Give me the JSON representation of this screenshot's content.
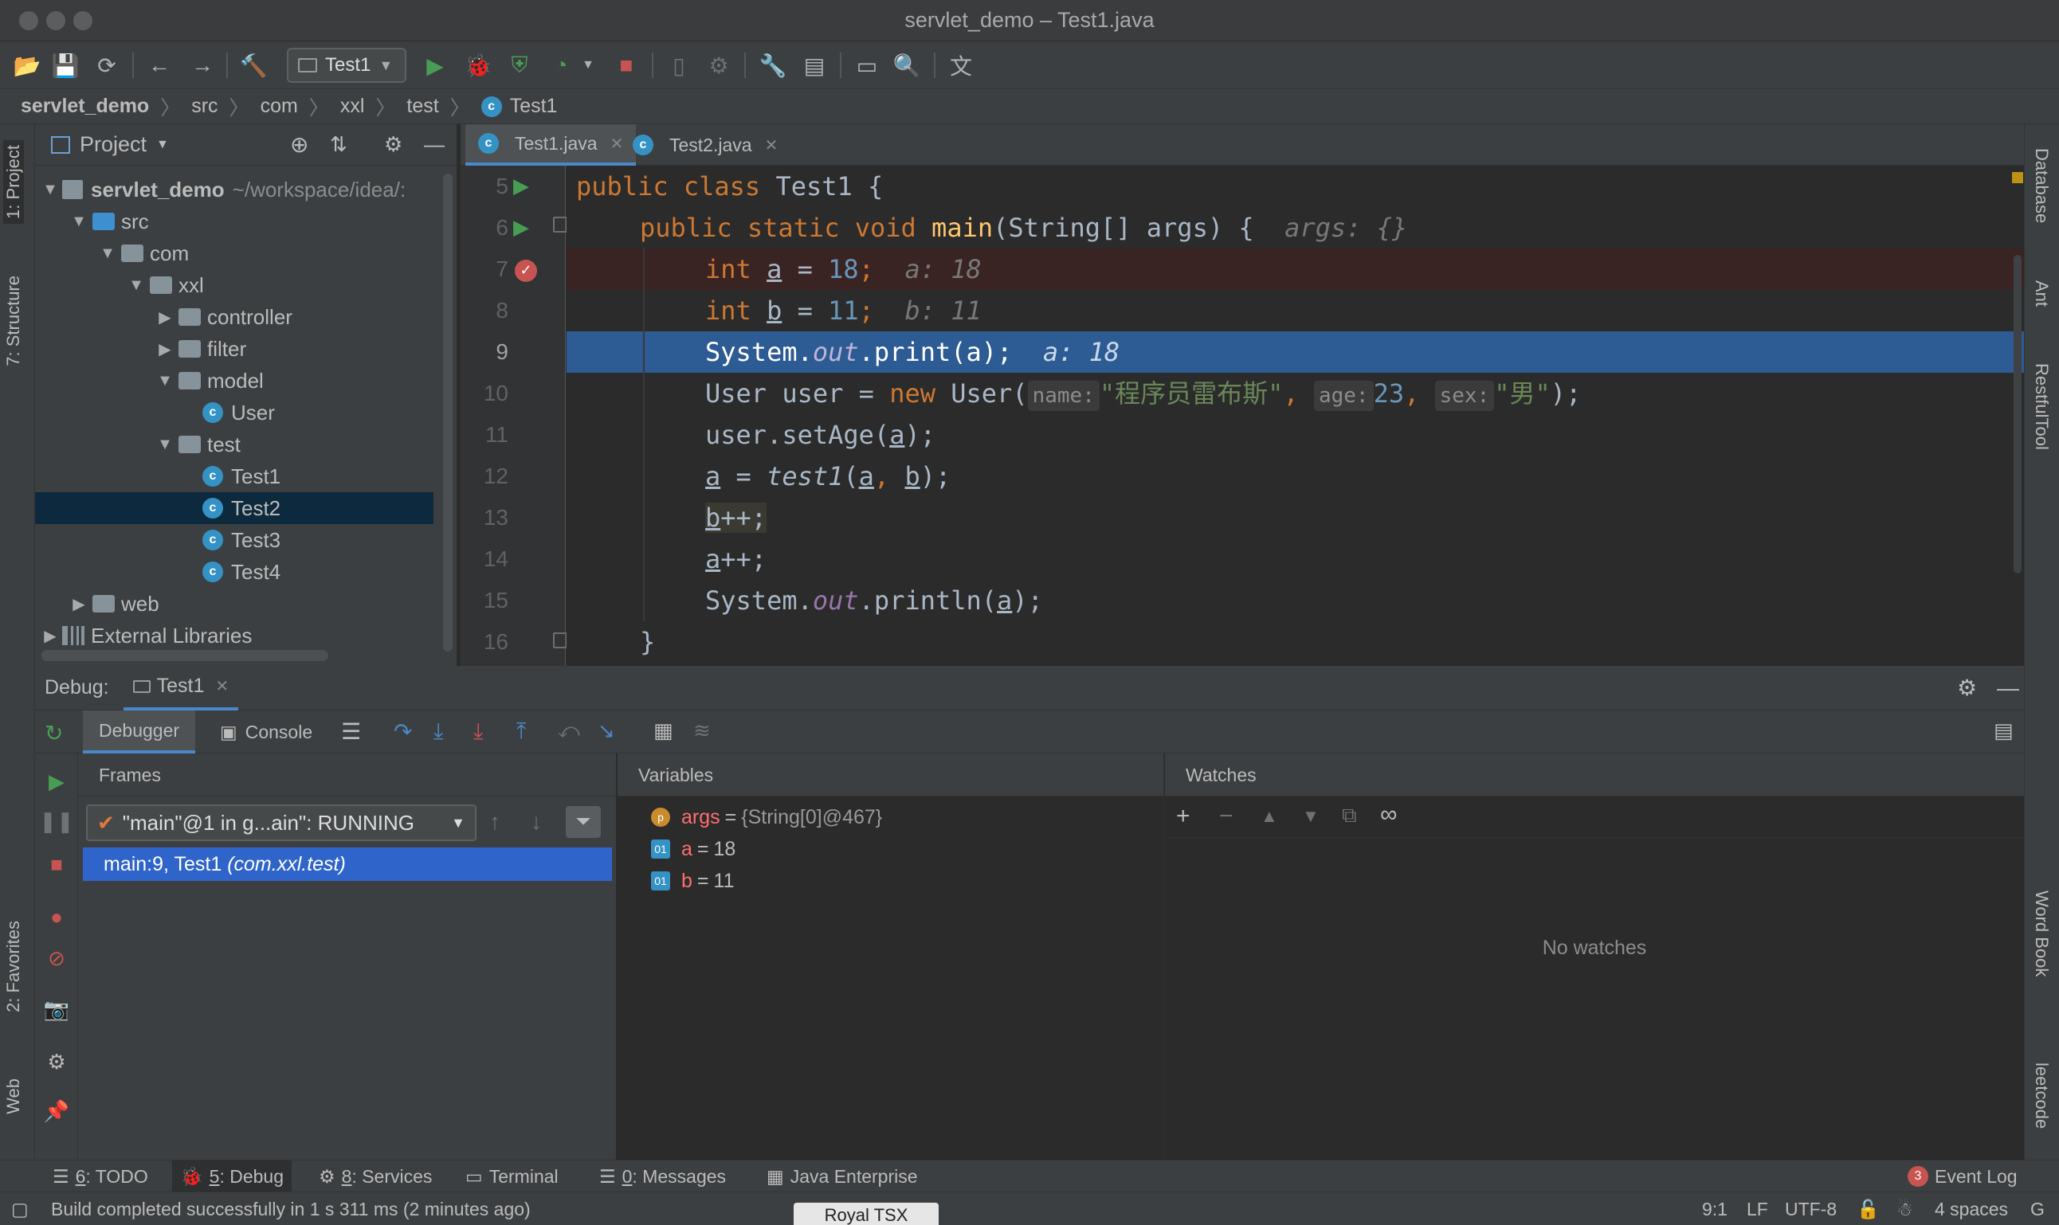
{
  "window": {
    "title": "servlet_demo – Test1.java"
  },
  "toolbar": {
    "run_config": "Test1",
    "icons": [
      "open-icon",
      "save-icon",
      "sync-icon",
      "back-icon",
      "forward-icon",
      "build-icon",
      "run-icon",
      "debug-icon",
      "coverage-icon",
      "profile-icon",
      "stop-icon",
      "device-icon",
      "attach-icon",
      "settings-wrench-icon",
      "project-structure-icon",
      "terminal-icon",
      "search-icon",
      "translate-icon"
    ]
  },
  "breadcrumb": [
    "servlet_demo",
    "src",
    "com",
    "xxl",
    "test",
    "Test1"
  ],
  "left_strip": {
    "tabs": [
      "1: Project",
      "7: Structure",
      "2: Favorites",
      "Web"
    ]
  },
  "right_strip": {
    "tabs": [
      "Database",
      "Ant",
      "RestfulTool",
      "Word Book",
      "leetcode"
    ]
  },
  "project": {
    "header": "Project",
    "tree": [
      {
        "label": "servlet_demo",
        "suffix": "~/workspace/idea/:",
        "type": "module",
        "depth": 0,
        "arrow": "▼"
      },
      {
        "label": "src",
        "type": "folder-blue",
        "depth": 1,
        "arrow": "▼"
      },
      {
        "label": "com",
        "type": "folder",
        "depth": 2,
        "arrow": "▼"
      },
      {
        "label": "xxl",
        "type": "folder",
        "depth": 3,
        "arrow": "▼"
      },
      {
        "label": "controller",
        "type": "folder",
        "depth": 4,
        "arrow": "▶"
      },
      {
        "label": "filter",
        "type": "folder",
        "depth": 4,
        "arrow": "▶"
      },
      {
        "label": "model",
        "type": "folder",
        "depth": 4,
        "arrow": "▼"
      },
      {
        "label": "User",
        "type": "class",
        "depth": 5,
        "arrow": ""
      },
      {
        "label": "test",
        "type": "folder",
        "depth": 4,
        "arrow": "▼"
      },
      {
        "label": "Test1",
        "type": "class",
        "depth": 5,
        "arrow": ""
      },
      {
        "label": "Test2",
        "type": "class",
        "depth": 5,
        "arrow": "",
        "selected": true
      },
      {
        "label": "Test3",
        "type": "class",
        "depth": 5,
        "arrow": ""
      },
      {
        "label": "Test4",
        "type": "class",
        "depth": 5,
        "arrow": ""
      },
      {
        "label": "web",
        "type": "folder",
        "depth": 1,
        "arrow": "▶"
      },
      {
        "label": "External Libraries",
        "type": "libs",
        "depth": 0,
        "arrow": "▶"
      }
    ]
  },
  "editor": {
    "tabs": [
      {
        "label": "Test1.java",
        "active": true
      },
      {
        "label": "Test2.java",
        "active": false
      }
    ],
    "lines": [
      5,
      6,
      7,
      8,
      9,
      10,
      11,
      12,
      13,
      14,
      15,
      16
    ],
    "current_line": 9,
    "code": {
      "l5": [
        "public",
        " ",
        "class",
        " Test1 {"
      ],
      "l6": [
        "public",
        " ",
        "static",
        " ",
        "void",
        " ",
        "main",
        "(String[] args) {",
        "args: {}"
      ],
      "l7": [
        "int",
        "a",
        " = ",
        "18",
        ";",
        "a: 18"
      ],
      "l8": [
        "int",
        "b",
        " = ",
        "11",
        ";",
        "b: 11"
      ],
      "l9": [
        "System.",
        "out",
        ".print(a);",
        "a: 18"
      ],
      "l10": [
        "User user = ",
        "new",
        " User(",
        "name:",
        "\"程序员雷布斯\"",
        ", ",
        "age:",
        "23",
        ", ",
        "sex:",
        "\"男\"",
        ");"
      ],
      "l11": [
        "user.setAge(",
        "a",
        ");"
      ],
      "l12": [
        "a",
        " = ",
        "test1",
        "(",
        "a",
        ", ",
        "b",
        ");"
      ],
      "l13": [
        "b",
        "++;"
      ],
      "l14": [
        "a",
        "++;"
      ],
      "l15": [
        "System.",
        "out",
        ".println(",
        "a",
        ");"
      ],
      "l16": [
        "}"
      ]
    }
  },
  "debug": {
    "label": "Debug:",
    "session": "Test1",
    "tabs": [
      "Debugger",
      "Console"
    ],
    "frames_title": "Frames",
    "thread": "\"main\"@1 in g...ain\": RUNNING",
    "frame": {
      "loc": "main:9, Test1",
      "pkg": "(com.xxl.test)"
    },
    "variables_title": "Variables",
    "variables": [
      {
        "badge": "p",
        "name": "args",
        "eq": " = ",
        "value": "{String[0]@467}"
      },
      {
        "badge": "01",
        "name": "a",
        "eq": " = ",
        "value": "18"
      },
      {
        "badge": "01",
        "name": "b",
        "eq": " = ",
        "value": "11"
      }
    ],
    "watches_title": "Watches",
    "no_watches": "No watches"
  },
  "tool_tabs": [
    {
      "num": "6",
      "label": ": TODO"
    },
    {
      "num": "5",
      "label": ": Debug",
      "active": true
    },
    {
      "num": "8",
      "label": ": Services"
    },
    {
      "num": "",
      "label": "Terminal"
    },
    {
      "num": "0",
      "label": ": Messages"
    },
    {
      "num": "",
      "label": "Java Enterprise"
    }
  ],
  "event_log": {
    "count": "3",
    "label": "Event Log"
  },
  "status": {
    "message": "Build completed successfully in 1 s 311 ms (2 minutes ago)",
    "position": "9:1",
    "line_sep": "LF",
    "encoding": "UTF-8",
    "indent": "4 spaces",
    "tooltip": "Royal TSX"
  },
  "colors": {
    "accent": "#4a88c7",
    "exec_line": "#2d5b93",
    "breakpoint_line": "#3a2323",
    "selection": "#2f65ca",
    "run_green": "#499c54",
    "stop_red": "#c75450"
  }
}
